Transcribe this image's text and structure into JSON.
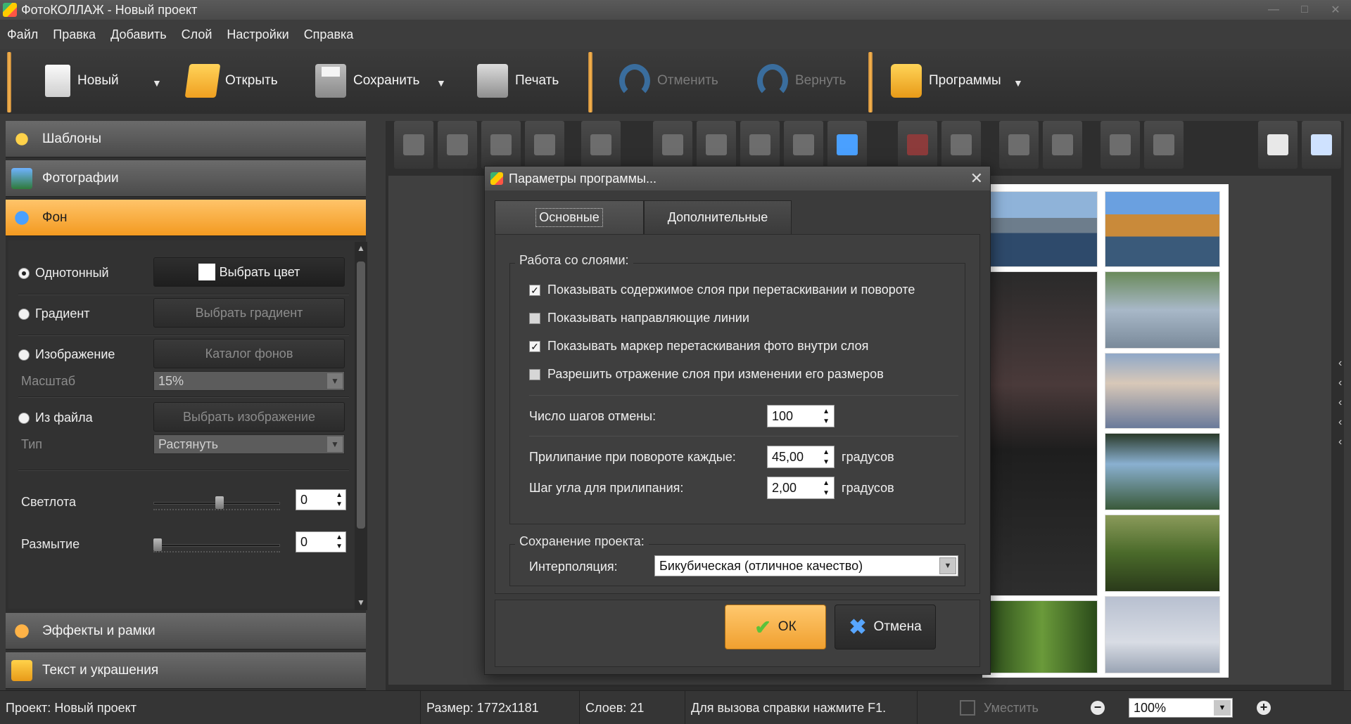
{
  "window": {
    "title": "ФотоКОЛЛАЖ - Новый проект"
  },
  "menu": [
    "Файл",
    "Правка",
    "Добавить",
    "Слой",
    "Настройки",
    "Справка"
  ],
  "toolbar": {
    "new_label": "Новый",
    "open_label": "Открыть",
    "save_label": "Сохранить",
    "print_label": "Печать",
    "undo_label": "Отменить",
    "redo_label": "Вернуть",
    "programs_label": "Программы"
  },
  "sidebar": {
    "templates": "Шаблоны",
    "photos": "Фотографии",
    "background": "Фон",
    "effects": "Эффекты и рамки",
    "text": "Текст и украшения"
  },
  "background_panel": {
    "solid": "Однотонный",
    "solid_button": "Выбрать цвет",
    "gradient": "Градиент",
    "gradient_button": "Выбрать градиент",
    "image": "Изображение",
    "image_button": "Каталог фонов",
    "scale_label": "Масштаб",
    "scale_value": "15%",
    "from_file": "Из файла",
    "from_file_button": "Выбрать изображение",
    "type_label": "Тип",
    "type_value": "Растянуть",
    "brightness_label": "Светлота",
    "brightness_value": "0",
    "blur_label": "Размытие",
    "blur_value": "0"
  },
  "dialog": {
    "title": "Параметры программы...",
    "tab_main": "Основные",
    "tab_extra": "Дополнительные",
    "layers_group": "Работа со слоями:",
    "chk1": "Показывать содержимое слоя при перетаскивании и повороте",
    "chk2": "Показывать направляющие линии",
    "chk3": "Показывать маркер перетаскивания фото внутри слоя",
    "chk4": "Разрешить отражение слоя при изменении его размеров",
    "undo_steps_label": "Число шагов отмены:",
    "undo_steps_value": "100",
    "snap_rotate_label": "Прилипание при повороте каждые:",
    "snap_rotate_value": "45,00",
    "snap_step_label": "Шаг угла для прилипания:",
    "snap_step_value": "2,00",
    "degrees": "градусов",
    "save_group": "Сохранение проекта:",
    "interp_label": "Интерполяция:",
    "interp_value": "Бикубическая (отличное качество)",
    "ok": "ОК",
    "cancel": "Отмена"
  },
  "status": {
    "project_label": "Проект:",
    "project_value": "Новый проект",
    "size_label": "Размер:",
    "size_value": "1772x1181",
    "layers_label": "Слоев:",
    "layers_value": "21",
    "help": "Для вызова справки нажмите F1.",
    "fit": "Уместить",
    "zoom": "100%"
  },
  "colors": {
    "accent_orange": "#f39a20",
    "panel_dark": "#2f2f2f"
  }
}
